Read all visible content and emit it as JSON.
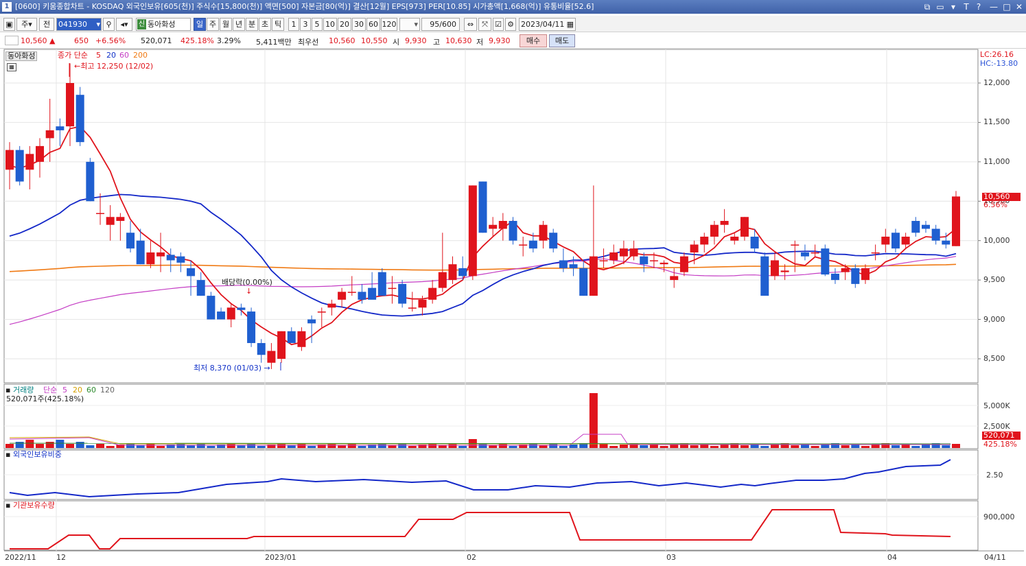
{
  "titlebar": {
    "num": "1",
    "title": "[0600] 키움종합차트 - KOSDAQ 외국인보유[605(천)] 주식수[15,800(천)] 액면[500] 자본금[80(억)] 결산[12월] EPS[973] PER[10.85] 시가총액[1,668(억)] 유통비율[52.6]",
    "controls": [
      "⧉",
      "▭",
      "▾",
      "T",
      "?",
      "—",
      "□",
      "✕"
    ]
  },
  "toolbar": {
    "period_toggle": "주",
    "range_label": "전",
    "code": "041930",
    "stock_badge": "신",
    "stock_name": "동아화성",
    "periods": [
      "일",
      "주",
      "월",
      "년",
      "분",
      "초",
      "틱"
    ],
    "intervals": [
      "1",
      "3",
      "5",
      "10",
      "20",
      "30",
      "60",
      "120"
    ],
    "count": "95",
    "count_total": "/600",
    "date": "2023/04/11"
  },
  "infobar": {
    "price": "10,560",
    "change": "650",
    "change_pct": "+6.56%",
    "volume": "520,071",
    "volume_pct": "425.18%",
    "turnover": "3.29%",
    "amount": "5,411백만",
    "best_label": "최우선",
    "best_ask": "10,560",
    "best_bid": "10,550",
    "open_label": "시",
    "open": "9,930",
    "high_label": "고",
    "high": "10,630",
    "low_label": "저",
    "low": "9,930",
    "buy": "매수",
    "sell": "매도"
  },
  "price_panel": {
    "stock_label": "동아화성",
    "ma_label": "종가 단순",
    "ma_periods": [
      "5",
      "20",
      "60",
      "200"
    ],
    "lc": "LC:26.16",
    "hc": "HC:-13.80",
    "high_note": "최고 12,250 (12/02)",
    "low_note": "최저 8,370 (01/03)",
    "div_note": "배당락(0.00%)",
    "last_price": "10,560",
    "last_pct": "6.56%",
    "y_ticks": [
      "12,000",
      "11,500",
      "11,000",
      "10,500",
      "10,000",
      "9,500",
      "9,000",
      "8,500"
    ]
  },
  "volume_panel": {
    "label": "거래량",
    "ma_label": "단순",
    "ma_periods": [
      "5",
      "20",
      "60",
      "120"
    ],
    "current": "520,071주(425.18%)",
    "y_ticks": [
      "5,000K",
      "2,500K"
    ],
    "last_value": "520,071",
    "last_pct": "425.18%"
  },
  "foreign_panel": {
    "label": "외국인보유비중",
    "y_ticks": [
      "2.50"
    ]
  },
  "inst_panel": {
    "label": "기관보유수량",
    "y_ticks": [
      "900,000"
    ]
  },
  "x_axis": [
    "2022/11",
    "12",
    "2023/01",
    "02",
    "03",
    "04",
    "04/11"
  ],
  "colors": {
    "up": "#e0141c",
    "down": "#1f5fd0",
    "ma5": "#e0141c",
    "ma20": "#1428c8",
    "ma60": "#c43cc4",
    "ma200": "#f07a14"
  },
  "chart_data": {
    "type": "candlestick",
    "ylim": [
      8200,
      12500
    ],
    "candles": [
      {
        "o": 10900,
        "h": 11250,
        "l": 10650,
        "c": 11150
      },
      {
        "o": 11150,
        "h": 11200,
        "l": 10700,
        "c": 10750
      },
      {
        "o": 10900,
        "h": 11200,
        "l": 10650,
        "c": 11100
      },
      {
        "o": 11000,
        "h": 11300,
        "l": 10800,
        "c": 11200
      },
      {
        "o": 11300,
        "h": 11800,
        "l": 11000,
        "c": 11400
      },
      {
        "o": 11450,
        "h": 11550,
        "l": 11200,
        "c": 11400
      },
      {
        "o": 11450,
        "h": 12250,
        "l": 11200,
        "c": 12000
      },
      {
        "o": 11850,
        "h": 11950,
        "l": 11200,
        "c": 11250
      },
      {
        "o": 11000,
        "h": 11050,
        "l": 10500,
        "c": 10500
      },
      {
        "o": 10350,
        "h": 10600,
        "l": 10200,
        "c": 10350
      },
      {
        "o": 10200,
        "h": 10450,
        "l": 10000,
        "c": 10300
      },
      {
        "o": 10250,
        "h": 10350,
        "l": 10000,
        "c": 10300
      },
      {
        "o": 10100,
        "h": 10250,
        "l": 9850,
        "c": 9900
      },
      {
        "o": 10000,
        "h": 10150,
        "l": 9700,
        "c": 9700
      },
      {
        "o": 9700,
        "h": 10000,
        "l": 9650,
        "c": 9850
      },
      {
        "o": 9800,
        "h": 10100,
        "l": 9600,
        "c": 9850
      },
      {
        "o": 9820,
        "h": 9900,
        "l": 9600,
        "c": 9750
      },
      {
        "o": 9800,
        "h": 9850,
        "l": 9600,
        "c": 9720
      },
      {
        "o": 9650,
        "h": 9750,
        "l": 9300,
        "c": 9550
      },
      {
        "o": 9500,
        "h": 9600,
        "l": 9300,
        "c": 9300
      },
      {
        "o": 9300,
        "h": 9350,
        "l": 9000,
        "c": 9000
      },
      {
        "o": 9100,
        "h": 9150,
        "l": 9000,
        "c": 9000
      },
      {
        "o": 9000,
        "h": 9200,
        "l": 8900,
        "c": 9150
      },
      {
        "o": 9150,
        "h": 9200,
        "l": 9050,
        "c": 9120
      },
      {
        "o": 9100,
        "h": 9150,
        "l": 8650,
        "c": 8700
      },
      {
        "o": 8700,
        "h": 8750,
        "l": 8450,
        "c": 8550
      },
      {
        "o": 8450,
        "h": 8700,
        "l": 8370,
        "c": 8600
      },
      {
        "o": 8500,
        "h": 8850,
        "l": 8450,
        "c": 8850
      },
      {
        "o": 8850,
        "h": 8900,
        "l": 8700,
        "c": 8700
      },
      {
        "o": 8650,
        "h": 8900,
        "l": 8600,
        "c": 8850
      },
      {
        "o": 9000,
        "h": 9050,
        "l": 8700,
        "c": 8950
      },
      {
        "o": 9100,
        "h": 9150,
        "l": 8900,
        "c": 9100
      },
      {
        "o": 9150,
        "h": 9250,
        "l": 9050,
        "c": 9200
      },
      {
        "o": 9250,
        "h": 9400,
        "l": 9150,
        "c": 9350
      },
      {
        "o": 9350,
        "h": 9550,
        "l": 9300,
        "c": 9350
      },
      {
        "o": 9350,
        "h": 9450,
        "l": 9200,
        "c": 9250
      },
      {
        "o": 9400,
        "h": 9600,
        "l": 9300,
        "c": 9250
      },
      {
        "o": 9600,
        "h": 9650,
        "l": 9300,
        "c": 9300
      },
      {
        "o": 9400,
        "h": 9550,
        "l": 9200,
        "c": 9400
      },
      {
        "o": 9450,
        "h": 9500,
        "l": 9150,
        "c": 9200
      },
      {
        "o": 9150,
        "h": 9350,
        "l": 9100,
        "c": 9150
      },
      {
        "o": 9150,
        "h": 9300,
        "l": 9050,
        "c": 9250
      },
      {
        "o": 9250,
        "h": 9500,
        "l": 9200,
        "c": 9400
      },
      {
        "o": 9400,
        "h": 10100,
        "l": 9350,
        "c": 9600
      },
      {
        "o": 9500,
        "h": 9800,
        "l": 9450,
        "c": 9700
      },
      {
        "o": 9650,
        "h": 9800,
        "l": 9500,
        "c": 9550
      },
      {
        "o": 9550,
        "h": 10700,
        "l": 9500,
        "c": 10700
      },
      {
        "o": 10750,
        "h": 10750,
        "l": 10100,
        "c": 10100
      },
      {
        "o": 10150,
        "h": 10300,
        "l": 10050,
        "c": 10200
      },
      {
        "o": 10150,
        "h": 10350,
        "l": 10000,
        "c": 10250
      },
      {
        "o": 10250,
        "h": 10300,
        "l": 9950,
        "c": 10000
      },
      {
        "o": 9950,
        "h": 10050,
        "l": 9800,
        "c": 9950
      },
      {
        "o": 10000,
        "h": 10100,
        "l": 9850,
        "c": 9900
      },
      {
        "o": 10000,
        "h": 10250,
        "l": 9900,
        "c": 10200
      },
      {
        "o": 10100,
        "h": 10150,
        "l": 9850,
        "c": 9900
      },
      {
        "o": 9750,
        "h": 9900,
        "l": 9600,
        "c": 9650
      },
      {
        "o": 9700,
        "h": 9800,
        "l": 9550,
        "c": 9650
      },
      {
        "o": 9650,
        "h": 9750,
        "l": 9300,
        "c": 9300
      },
      {
        "o": 9300,
        "h": 10700,
        "l": 9300,
        "c": 9800
      },
      {
        "o": 9750,
        "h": 9900,
        "l": 9650,
        "c": 9750
      },
      {
        "o": 9750,
        "h": 9950,
        "l": 9700,
        "c": 9850
      },
      {
        "o": 9800,
        "h": 10000,
        "l": 9700,
        "c": 9900
      },
      {
        "o": 9800,
        "h": 10000,
        "l": 9750,
        "c": 9900
      },
      {
        "o": 9800,
        "h": 9850,
        "l": 9600,
        "c": 9700
      },
      {
        "o": 9750,
        "h": 9850,
        "l": 9650,
        "c": 9750
      },
      {
        "o": 9700,
        "h": 9750,
        "l": 9600,
        "c": 9720
      },
      {
        "o": 9500,
        "h": 9650,
        "l": 9400,
        "c": 9550
      },
      {
        "o": 9600,
        "h": 9850,
        "l": 9550,
        "c": 9800
      },
      {
        "o": 9850,
        "h": 10000,
        "l": 9700,
        "c": 9950
      },
      {
        "o": 9950,
        "h": 10100,
        "l": 9850,
        "c": 10050
      },
      {
        "o": 10050,
        "h": 10250,
        "l": 9950,
        "c": 10200
      },
      {
        "o": 10200,
        "h": 10400,
        "l": 10100,
        "c": 10250
      },
      {
        "o": 10000,
        "h": 10100,
        "l": 9950,
        "c": 10050
      },
      {
        "o": 10050,
        "h": 10300,
        "l": 10000,
        "c": 10300
      },
      {
        "o": 10050,
        "h": 10150,
        "l": 9850,
        "c": 9900
      },
      {
        "o": 9800,
        "h": 9850,
        "l": 9450,
        "c": 9300
      },
      {
        "o": 9550,
        "h": 9850,
        "l": 9500,
        "c": 9750
      },
      {
        "o": 9600,
        "h": 9700,
        "l": 9500,
        "c": 9620
      },
      {
        "o": 9950,
        "h": 10000,
        "l": 9600,
        "c": 9950
      },
      {
        "o": 9850,
        "h": 9950,
        "l": 9750,
        "c": 9800
      },
      {
        "o": 9850,
        "h": 9950,
        "l": 9800,
        "c": 9850
      },
      {
        "o": 9900,
        "h": 9950,
        "l": 9550,
        "c": 9570
      },
      {
        "o": 9580,
        "h": 9650,
        "l": 9450,
        "c": 9500
      },
      {
        "o": 9600,
        "h": 9700,
        "l": 9500,
        "c": 9650
      },
      {
        "o": 9650,
        "h": 9700,
        "l": 9400,
        "c": 9450
      },
      {
        "o": 9500,
        "h": 9700,
        "l": 9450,
        "c": 9650
      },
      {
        "o": 9850,
        "h": 9950,
        "l": 9750,
        "c": 9850
      },
      {
        "o": 9950,
        "h": 10150,
        "l": 9850,
        "c": 10050
      },
      {
        "o": 10100,
        "h": 10150,
        "l": 9850,
        "c": 9900
      },
      {
        "o": 9950,
        "h": 10100,
        "l": 9900,
        "c": 10050
      },
      {
        "o": 10250,
        "h": 10300,
        "l": 10050,
        "c": 10100
      },
      {
        "o": 10200,
        "h": 10250,
        "l": 10100,
        "c": 10150
      },
      {
        "o": 10150,
        "h": 10200,
        "l": 9950,
        "c": 10000
      },
      {
        "o": 10000,
        "h": 10100,
        "l": 9900,
        "c": 9950
      },
      {
        "o": 9930,
        "h": 10630,
        "l": 9930,
        "c": 10560
      }
    ]
  }
}
